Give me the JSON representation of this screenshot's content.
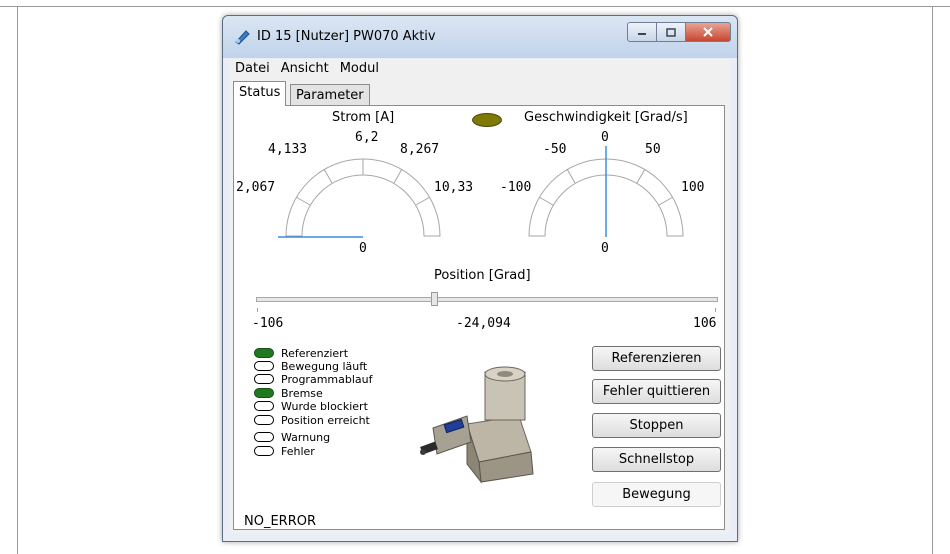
{
  "window": {
    "title": "ID 15 [Nutzer] PW070 Aktiv",
    "controls": [
      "minimize-icon",
      "maximize-icon",
      "close-icon"
    ]
  },
  "menu": [
    "Datei",
    "Ansicht",
    "Modul"
  ],
  "tabs": [
    "Status",
    "Parameter"
  ],
  "strom_gauge": {
    "title": "Strom [A]",
    "ticks": [
      "2,067",
      "4,133",
      "6,2",
      "8,267",
      "10,33"
    ],
    "zero": "0",
    "value": 0
  },
  "speed_gauge": {
    "title": "Geschwindigkeit [Grad/s]",
    "ticks": [
      "-100",
      "-50",
      "0",
      "50",
      "100"
    ],
    "zero": "0",
    "value": 0
  },
  "indicator_color": "#7f7a07",
  "position": {
    "title": "Position [Grad]",
    "min": "-106",
    "value": "-24,094",
    "max": "106",
    "value_numeric": -24.094
  },
  "status_leds": [
    {
      "label": "Referenziert",
      "on": true
    },
    {
      "label": "Bewegung läuft",
      "on": false
    },
    {
      "label": "Programmablauf",
      "on": false
    },
    {
      "label": "Bremse",
      "on": true
    },
    {
      "label": "Wurde blockiert",
      "on": false
    },
    {
      "label": "Position erreicht",
      "on": false
    },
    {
      "label": "Warnung",
      "on": false
    },
    {
      "label": "Fehler",
      "on": false
    }
  ],
  "led_on_color": "#1f7a1f",
  "buttons": {
    "referenzieren": "Referenzieren",
    "fehler_quittieren": "Fehler quittieren",
    "stoppen": "Stoppen",
    "schnellstop": "Schnellstop",
    "bewegung": "Bewegung"
  },
  "status_text": "NO_ERROR"
}
